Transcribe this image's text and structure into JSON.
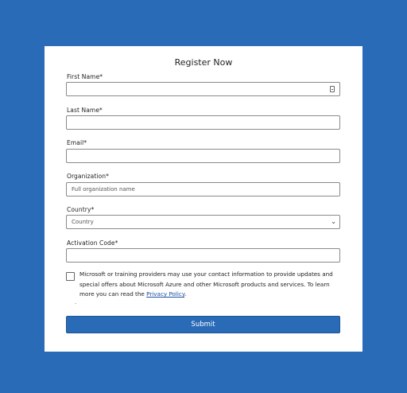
{
  "form": {
    "title": "Register Now",
    "first_name_label": "First Name*",
    "last_name_label": "Last Name*",
    "email_label": "Email*",
    "organization_label": "Organization*",
    "organization_placeholder": "Full organization name",
    "country_label": "Country*",
    "country_selected": "Country",
    "activation_label": "Activation Code*",
    "consent_text": "Microsoft or training providers may use your contact information to provide updates and special offers about Microsoft Azure and other Microsoft products and services. To learn more you can read the ",
    "privacy_link": "Privacy Policy",
    "consent_end": ".",
    "dot": ".",
    "submit_label": "Submit"
  },
  "colors": {
    "background": "#2a6bb7",
    "submit": "#2a6bb7",
    "link": "#1a4fa0"
  }
}
